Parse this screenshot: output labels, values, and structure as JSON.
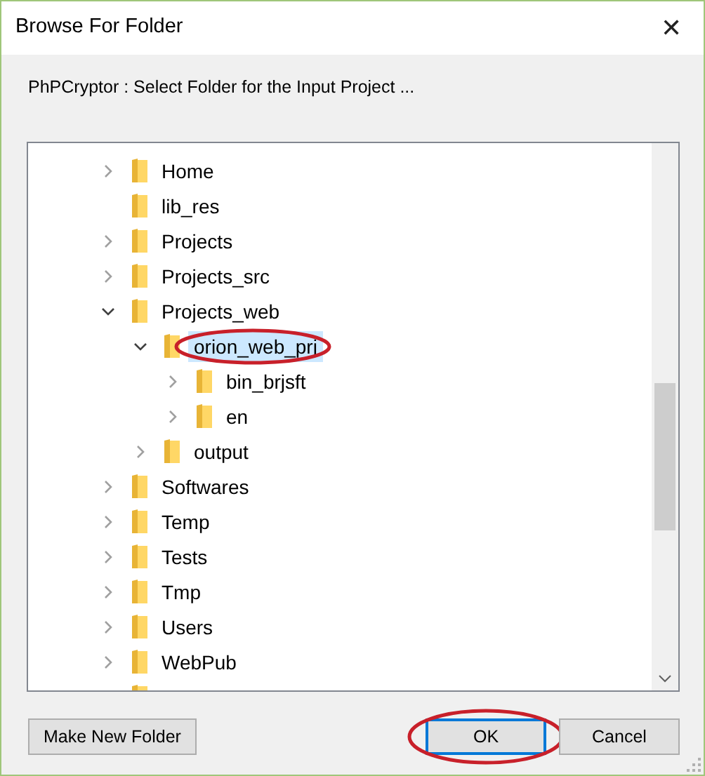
{
  "window": {
    "title": "Browse For Folder",
    "close": "✕"
  },
  "instruction": "PhPCryptor : Select Folder for the Input Project ...",
  "tree": {
    "items": [
      {
        "label": "Home",
        "expandable": true,
        "expanded": false,
        "selected": false
      },
      {
        "label": "lib_res",
        "expandable": false,
        "selected": false
      },
      {
        "label": "Projects",
        "expandable": true,
        "expanded": false,
        "selected": false
      },
      {
        "label": "Projects_src",
        "expandable": true,
        "expanded": false,
        "selected": false
      },
      {
        "label": "Projects_web",
        "expandable": true,
        "expanded": true,
        "selected": false,
        "children": [
          {
            "label": "orion_web_prj",
            "expandable": true,
            "expanded": true,
            "selected": true,
            "circled": true,
            "children": [
              {
                "label": "bin_brjsft",
                "expandable": true,
                "expanded": false,
                "selected": false
              },
              {
                "label": "en",
                "expandable": true,
                "expanded": false,
                "selected": false
              }
            ]
          },
          {
            "label": "output",
            "expandable": true,
            "expanded": false,
            "selected": false
          }
        ]
      },
      {
        "label": "Softwares",
        "expandable": true,
        "expanded": false,
        "selected": false
      },
      {
        "label": "Temp",
        "expandable": true,
        "expanded": false,
        "selected": false
      },
      {
        "label": "Tests",
        "expandable": true,
        "expanded": false,
        "selected": false
      },
      {
        "label": "Tmp",
        "expandable": true,
        "expanded": false,
        "selected": false
      },
      {
        "label": "Users",
        "expandable": true,
        "expanded": false,
        "selected": false
      },
      {
        "label": "WebPub",
        "expandable": true,
        "expanded": false,
        "selected": false
      },
      {
        "partial": true
      }
    ]
  },
  "buttons": [
    {
      "label": "Make New Folder",
      "kind": "left",
      "default": false,
      "circled": false
    },
    {
      "label": "OK",
      "kind": "right",
      "default": true,
      "circled": true
    },
    {
      "label": "Cancel",
      "kind": "right",
      "default": false,
      "circled": false
    }
  ]
}
